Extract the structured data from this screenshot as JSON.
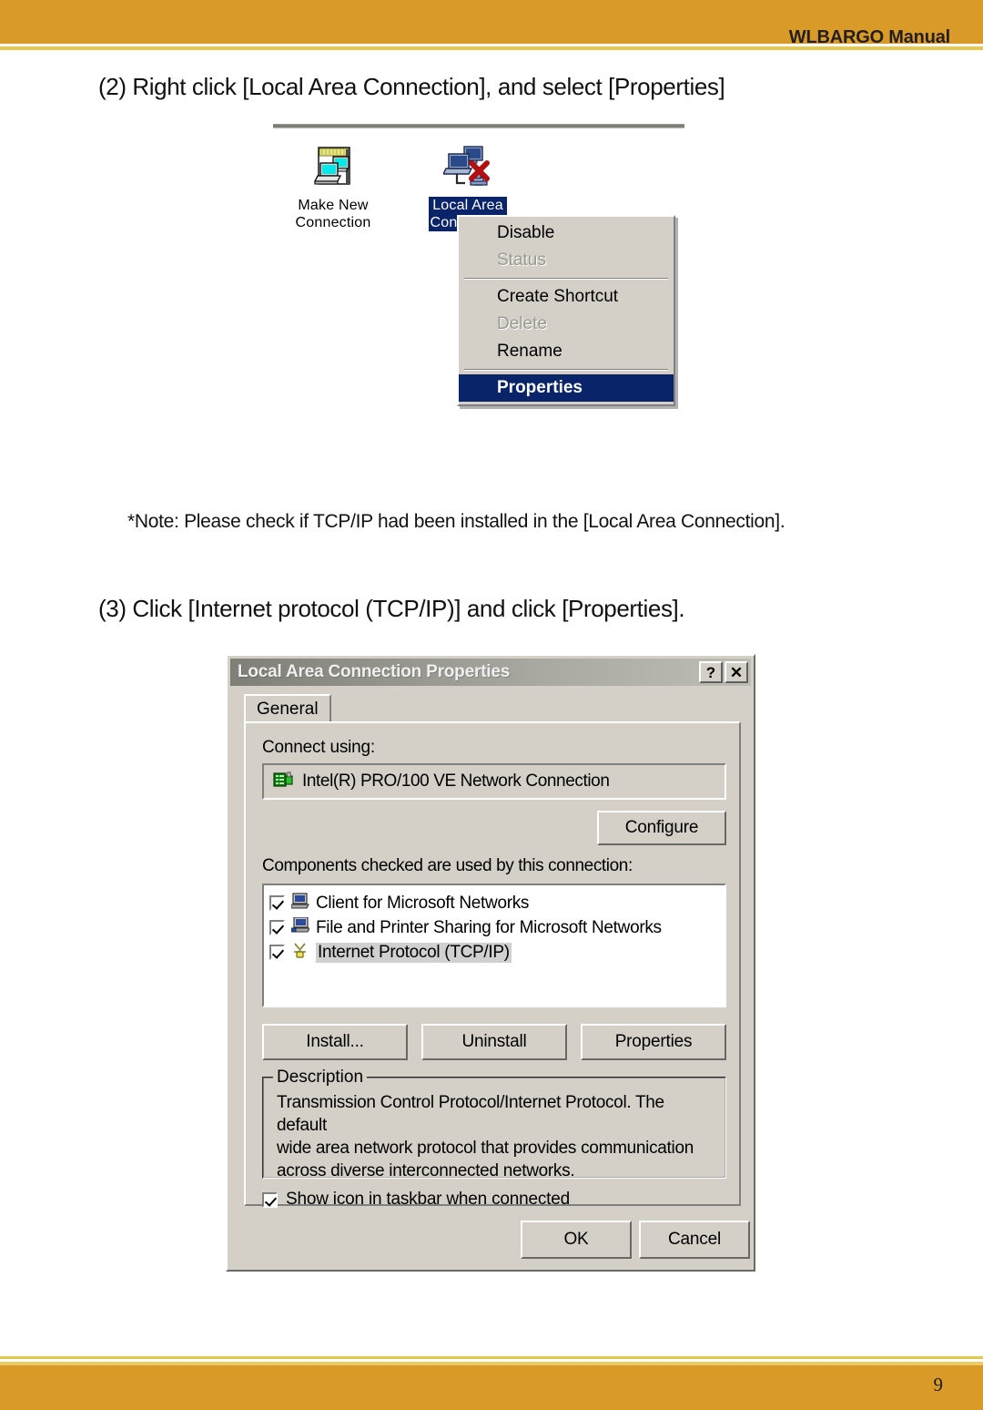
{
  "page": {
    "header_title": "WLBARGO Manual",
    "page_number": "9",
    "accent_color": "#d99a28",
    "accent_light": "#e8c84a"
  },
  "steps": {
    "step2": "(2) Right click [Local Area Connection], and select [Properties]",
    "note": "*Note: Please check if TCP/IP had been installed in the [Local Area Connection].",
    "step3": "(3) Click [Internet protocol (TCP/IP)] and click [Properties]."
  },
  "figure_connections": {
    "items": [
      {
        "label_line1": "Make New",
        "label_line2": "Connection",
        "icon": "make-new-connection-icon",
        "selected": false
      },
      {
        "label_line1": "Local Area",
        "label_line2": "Connection",
        "icon": "network-connection-disconnected-icon",
        "selected": true
      }
    ],
    "context_menu": [
      {
        "label": "Disable",
        "state": "enabled"
      },
      {
        "label": "Status",
        "state": "disabled"
      },
      {
        "separator": true
      },
      {
        "label": "Create Shortcut",
        "state": "enabled"
      },
      {
        "label": "Delete",
        "state": "disabled"
      },
      {
        "label": "Rename",
        "state": "enabled"
      },
      {
        "separator": true
      },
      {
        "label": "Properties",
        "state": "highlighted"
      }
    ],
    "highlight_color": "#0a246a"
  },
  "figure_dialog": {
    "title": "Local Area Connection Properties",
    "help_button": "?",
    "close_button": "✕",
    "tab": "General",
    "connect_using_label": "Connect using:",
    "adapter_name": "Intel(R) PRO/100 VE Network Connection",
    "adapter_icon": "network-adapter-icon",
    "configure_button": "Configure",
    "components_label": "Components checked are used by this connection:",
    "components": [
      {
        "label": "Client for Microsoft Networks",
        "checked": true,
        "selected": false,
        "icon": "computer-icon"
      },
      {
        "label": "File and Printer Sharing for Microsoft Networks",
        "checked": true,
        "selected": false,
        "icon": "computer-share-icon"
      },
      {
        "label": "Internet Protocol (TCP/IP)",
        "checked": true,
        "selected": true,
        "icon": "tcpip-protocol-icon"
      }
    ],
    "install_button": "Install...",
    "uninstall_button": "Uninstall",
    "properties_button": "Properties",
    "description_title": "Description",
    "description_line1": "Transmission Control Protocol/Internet Protocol.  The default",
    "description_line2": "wide area network protocol that provides communication",
    "description_line3": "across diverse interconnected networks.",
    "show_icon_label": "Show icon in taskbar when connected",
    "show_icon_checked": true,
    "ok_button": "OK",
    "cancel_button": "Cancel"
  }
}
